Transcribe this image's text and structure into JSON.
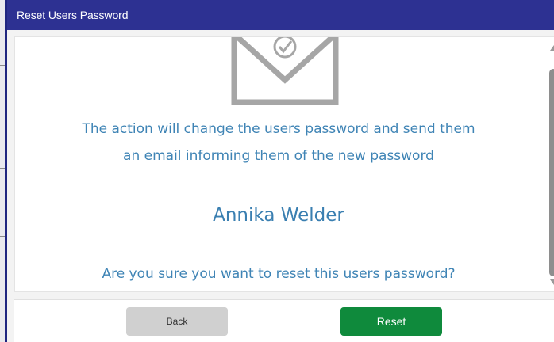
{
  "dialog": {
    "title": "Reset Users Password"
  },
  "content": {
    "icon": "envelope-check-icon",
    "message_line1": "The action will change the users password and send them",
    "message_line2": "an email informing them of the new password",
    "user_name": "Annika Welder",
    "confirm_question": "Are you sure you want to reset this users password?"
  },
  "footer": {
    "back_label": "Back",
    "reset_label": "Reset"
  },
  "colors": {
    "titlebar": "#2d3192",
    "text_accent": "#3f84b5",
    "reset_button": "#0f8a3c",
    "back_button": "#d0d0d0"
  }
}
